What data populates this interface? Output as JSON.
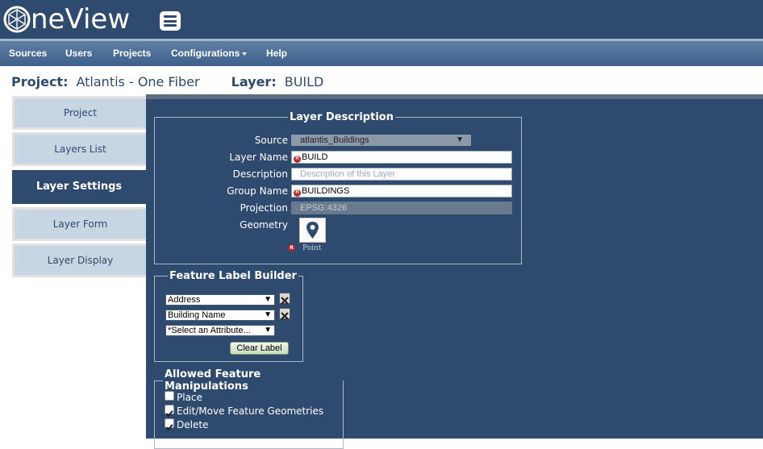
{
  "header": {
    "logo_text": "neView"
  },
  "nav": {
    "items": [
      {
        "label": "Sources"
      },
      {
        "label": "Users"
      },
      {
        "label": "Projects"
      },
      {
        "label": "Configurations"
      },
      {
        "label": "Help"
      }
    ]
  },
  "project": {
    "project_label": "Project:",
    "project_value": "Atlantis - One Fiber",
    "layer_label": "Layer:",
    "layer_value": "BUILD"
  },
  "sidebar": {
    "items": [
      {
        "label": "Project"
      },
      {
        "label": "Layers List"
      },
      {
        "label": "Layer Settings"
      },
      {
        "label": "Layer Form"
      },
      {
        "label": "Layer Display"
      }
    ]
  },
  "layer_description": {
    "legend": "Layer Description",
    "source_label": "Source",
    "source_value": "atlantis_Buildings",
    "name_label": "Layer Name",
    "name_value": "BUILD",
    "description_label": "Description",
    "description_placeholder": "Description of this Layer",
    "group_label": "Group Name",
    "group_value": "BUILDINGS",
    "projection_label": "Projection",
    "projection_value": "EPSG:4326",
    "geometry_label": "Geometry",
    "geometry_value": "Point"
  },
  "label_builder": {
    "legend": "Feature Label Builder",
    "selects": [
      "Address",
      "Building Name",
      "*Select an Attribute..."
    ],
    "clear_label": "Clear Label"
  },
  "manipulations": {
    "legend": "Allowed Feature Manipulations",
    "items": [
      {
        "label": "Place",
        "checked": false
      },
      {
        "label": "Edit/Move Feature Geometries",
        "checked": true
      },
      {
        "label": "Delete",
        "checked": true
      }
    ]
  },
  "colors": {
    "header_bg": "#2f4a6f",
    "tab_bg": "#c8d6e3",
    "required": "#c0242c"
  }
}
